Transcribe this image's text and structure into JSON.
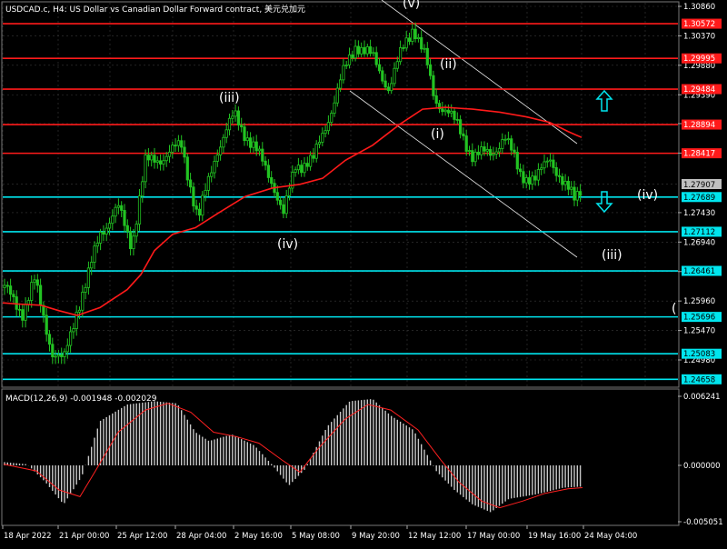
{
  "header": {
    "title": "USDCAD.c, H4:  US Dollar vs Canadian Dollar Forward contract, 美元兑加元"
  },
  "colors": {
    "background": "#000000",
    "grid": "#3a3a3a",
    "candle": "#22c322",
    "ma": "#ff1a1a",
    "resistance": "#ff1a1a",
    "support": "#00e5ee",
    "channel": "#e8e8e8",
    "macd_hist": "#c8c8c8",
    "macd_signal": "#ff2020",
    "axis_text": "#ffffff",
    "current_price_badge": "#c0c0c0"
  },
  "price_axis": {
    "ticks": [
      "1.30860",
      "1.30370",
      "1.29880",
      "1.29390",
      "1.28910",
      "1.28420",
      "1.27907",
      "1.27430",
      "1.26940",
      "1.26450",
      "1.25960",
      "1.25470",
      "1.24980"
    ],
    "current_price": "1.27907"
  },
  "levels": {
    "resistance": [
      "1.30572",
      "1.29995",
      "1.29484",
      "1.28894",
      "1.28417"
    ],
    "support": [
      "1.27689",
      "1.27112",
      "1.26461",
      "1.25696",
      "1.25083",
      "1.24658"
    ]
  },
  "wave_labels": [
    {
      "text": "(iii)",
      "name": "wave-label-iii-top"
    },
    {
      "text": "(iv)",
      "name": "wave-label-iv-left"
    },
    {
      "text": "(i)",
      "name": "wave-label-i"
    },
    {
      "text": "(ii)",
      "name": "wave-label-ii"
    },
    {
      "text": "(iv)",
      "name": "wave-label-iv-right"
    },
    {
      "text": "(iii)",
      "name": "wave-label-iii-right"
    },
    {
      "text": "(",
      "name": "wave-label-paren"
    },
    {
      "text": "(v)",
      "name": "wave-label-v-top"
    }
  ],
  "arrows": {
    "up": "up-arrow-icon",
    "down": "down-arrow-icon"
  },
  "macd": {
    "label": "MACD(12,26,9) -0.001948 -0.002029",
    "ticks": [
      "0.006241",
      "0.000000",
      "-0.005051"
    ]
  },
  "time_axis": {
    "labels": [
      "18 Apr 2022",
      "21 Apr 00:00",
      "25 Apr 12:00",
      "28 Apr 04:00",
      "2 May 16:00",
      "5 May 08:00",
      "9 May 20:00",
      "12 May 12:00",
      "17 May 00:00",
      "19 May 16:00",
      "24 May 04:00"
    ]
  }
}
